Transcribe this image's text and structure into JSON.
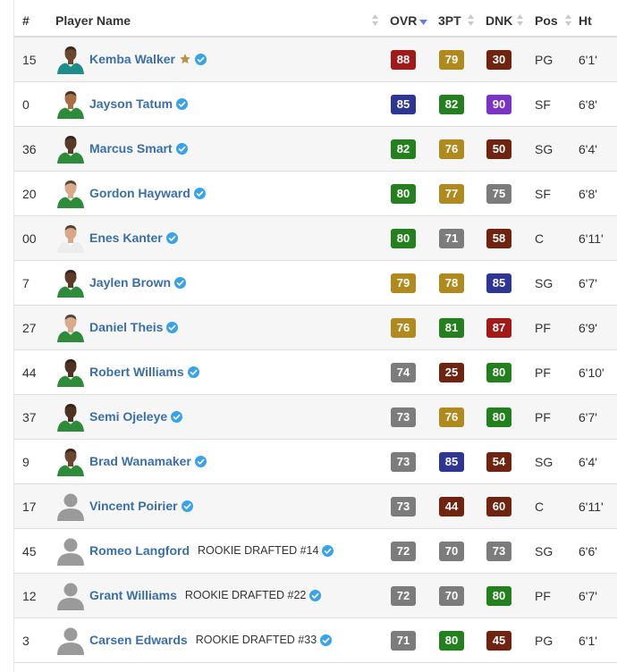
{
  "colors": {
    "red": "#a01a1a",
    "navy": "#2f3592",
    "green": "#24801f",
    "gold": "#b08a1e",
    "brown": "#6e2410",
    "purple": "#7a34c4",
    "gray": "#7c7c7c",
    "name_link": "#3a6fa8",
    "verified_badge": "#3aa2e6",
    "star": "#b49445"
  },
  "icons": {
    "verified": "check-circle-icon",
    "star": "star-icon",
    "sort": "sort-arrows-icon",
    "placeholder_avatar": "person-silhouette-icon"
  },
  "header": {
    "num": "#",
    "name": "Player Name",
    "ovr": "OVR",
    "three": "3PT",
    "dnk": "DNK",
    "pos": "Pos",
    "ht": "Ht"
  },
  "players": [
    {
      "num": "15",
      "name": "Kemba Walker",
      "star": true,
      "rookie": "",
      "ovr": "88",
      "ovr_color": "red",
      "three": "79",
      "three_color": "gold",
      "dnk": "30",
      "dnk_color": "brown",
      "pos": "PG",
      "ht": "6'1'",
      "avatar": "photo",
      "jersey": "#1e8c8a",
      "skin": "#6b4630"
    },
    {
      "num": "0",
      "name": "Jayson Tatum",
      "star": false,
      "rookie": "",
      "ovr": "85",
      "ovr_color": "navy",
      "three": "82",
      "three_color": "green",
      "dnk": "90",
      "dnk_color": "purple",
      "pos": "SF",
      "ht": "6'8'",
      "avatar": "photo",
      "jersey": "#2e8b3a",
      "skin": "#a56d48"
    },
    {
      "num": "36",
      "name": "Marcus Smart",
      "star": false,
      "rookie": "",
      "ovr": "82",
      "ovr_color": "green",
      "three": "76",
      "three_color": "gold",
      "dnk": "50",
      "dnk_color": "brown",
      "pos": "SG",
      "ht": "6'4'",
      "avatar": "photo",
      "jersey": "#2e8b3a",
      "skin": "#5a3a28"
    },
    {
      "num": "20",
      "name": "Gordon Hayward",
      "star": false,
      "rookie": "",
      "ovr": "80",
      "ovr_color": "green",
      "three": "77",
      "three_color": "gold",
      "dnk": "75",
      "dnk_color": "gray",
      "pos": "SF",
      "ht": "6'8'",
      "avatar": "photo",
      "jersey": "#2e8b3a",
      "skin": "#d8a98a"
    },
    {
      "num": "00",
      "name": "Enes Kanter",
      "star": false,
      "rookie": "",
      "ovr": "80",
      "ovr_color": "green",
      "three": "71",
      "three_color": "gray",
      "dnk": "58",
      "dnk_color": "brown",
      "pos": "C",
      "ht": "6'11'",
      "avatar": "photo",
      "jersey": "#ededed",
      "skin": "#d6a888"
    },
    {
      "num": "7",
      "name": "Jaylen Brown",
      "star": false,
      "rookie": "",
      "ovr": "79",
      "ovr_color": "gold",
      "three": "78",
      "three_color": "gold",
      "dnk": "85",
      "dnk_color": "navy",
      "pos": "SG",
      "ht": "6'7'",
      "avatar": "photo",
      "jersey": "#2e8b3a",
      "skin": "#5b3b28"
    },
    {
      "num": "27",
      "name": "Daniel Theis",
      "star": false,
      "rookie": "",
      "ovr": "76",
      "ovr_color": "gold",
      "three": "81",
      "three_color": "green",
      "dnk": "87",
      "dnk_color": "red",
      "pos": "PF",
      "ht": "6'9'",
      "avatar": "photo",
      "jersey": "#2e8b3a",
      "skin": "#d9ab8c"
    },
    {
      "num": "44",
      "name": "Robert Williams",
      "star": false,
      "rookie": "",
      "ovr": "74",
      "ovr_color": "gray",
      "three": "25",
      "three_color": "brown",
      "dnk": "80",
      "dnk_color": "green",
      "pos": "PF",
      "ht": "6'10'",
      "avatar": "photo",
      "jersey": "#2e8b3a",
      "skin": "#4f3222"
    },
    {
      "num": "37",
      "name": "Semi Ojeleye",
      "star": false,
      "rookie": "",
      "ovr": "73",
      "ovr_color": "gray",
      "three": "76",
      "three_color": "gold",
      "dnk": "80",
      "dnk_color": "green",
      "pos": "PF",
      "ht": "6'7'",
      "avatar": "photo",
      "jersey": "#2e8b3a",
      "skin": "#4e3121"
    },
    {
      "num": "9",
      "name": "Brad Wanamaker",
      "star": false,
      "rookie": "",
      "ovr": "73",
      "ovr_color": "gray",
      "three": "85",
      "three_color": "navy",
      "dnk": "54",
      "dnk_color": "brown",
      "pos": "SG",
      "ht": "6'4'",
      "avatar": "photo",
      "jersey": "#2e8b3a",
      "skin": "#6a4530"
    },
    {
      "num": "17",
      "name": "Vincent Poirier",
      "star": false,
      "rookie": "",
      "ovr": "73",
      "ovr_color": "gray",
      "three": "44",
      "three_color": "brown",
      "dnk": "60",
      "dnk_color": "brown",
      "pos": "C",
      "ht": "6'11'",
      "avatar": "placeholder",
      "jersey": "",
      "skin": ""
    },
    {
      "num": "45",
      "name": "Romeo Langford",
      "star": false,
      "rookie": "ROOKIE DRAFTED #14",
      "ovr": "72",
      "ovr_color": "gray",
      "three": "70",
      "three_color": "gray",
      "dnk": "73",
      "dnk_color": "gray",
      "pos": "SG",
      "ht": "6'6'",
      "avatar": "placeholder",
      "jersey": "",
      "skin": ""
    },
    {
      "num": "12",
      "name": "Grant Williams",
      "star": false,
      "rookie": "ROOKIE DRAFTED #22",
      "ovr": "72",
      "ovr_color": "gray",
      "three": "70",
      "three_color": "gray",
      "dnk": "80",
      "dnk_color": "green",
      "pos": "PF",
      "ht": "6'7'",
      "avatar": "placeholder",
      "jersey": "",
      "skin": ""
    },
    {
      "num": "3",
      "name": "Carsen Edwards",
      "star": false,
      "rookie": "ROOKIE DRAFTED #33",
      "ovr": "71",
      "ovr_color": "gray",
      "three": "80",
      "three_color": "green",
      "dnk": "45",
      "dnk_color": "brown",
      "pos": "PG",
      "ht": "6'1'",
      "avatar": "placeholder",
      "jersey": "",
      "skin": ""
    }
  ]
}
